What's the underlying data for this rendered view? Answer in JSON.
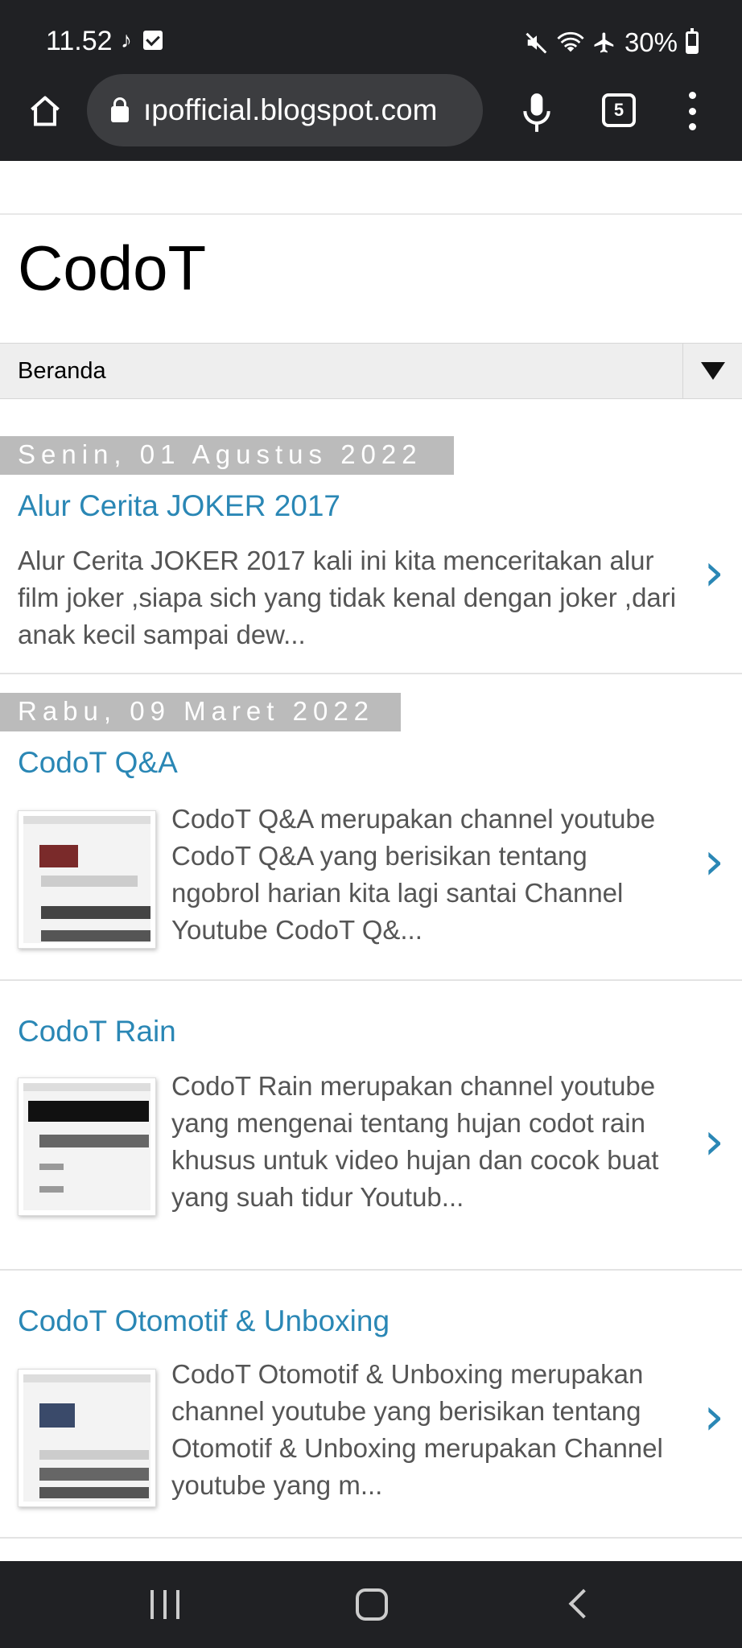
{
  "status_bar": {
    "time": "11.52",
    "battery": "30%"
  },
  "browser": {
    "url": "ıpofficial.blogspot.com",
    "tab_count": "5"
  },
  "blog": {
    "title": "CodoT",
    "nav_selected": "Beranda"
  },
  "dates": [
    "Senin, 01 Agustus 2022",
    "Rabu, 09 Maret 2022"
  ],
  "posts": [
    {
      "title": "Alur Cerita JOKER 2017",
      "snippet": "  Alur Cerita JOKER 2017  kali ini kita menceritakan alur  film joker ,siapa sich yang tidak kenal dengan joker ,dari anak kecil sampai dew..."
    },
    {
      "title": "CodoT Q&A",
      "snippet": "  CodoT Q&A merupakan channel youtube  CodoT Q&A yang berisikan tentang ngobrol harian kita lagi santai  Channel Youtube CodoT Q&..."
    },
    {
      "title": "CodoT Rain",
      "snippet": "  CodoT Rain merupakan channel youtube yang mengenai tentang hujan codot rain khusus untuk video hujan dan cocok buat yang suah tidur Youtub..."
    },
    {
      "title": "CodoT Otomotif & Unboxing",
      "snippet": "  CodoT Otomotif & Unboxing merupakan channel youtube yang berisikan tentang  Otomotif & Unboxing  merupakan Channel youtube yang m..."
    }
  ],
  "icons": {
    "chevron": "›",
    "tiktok": "♪"
  },
  "colors": {
    "link": "#2a87b5",
    "date_bg": "#bbbbbb",
    "chrome_bg": "#202124"
  }
}
